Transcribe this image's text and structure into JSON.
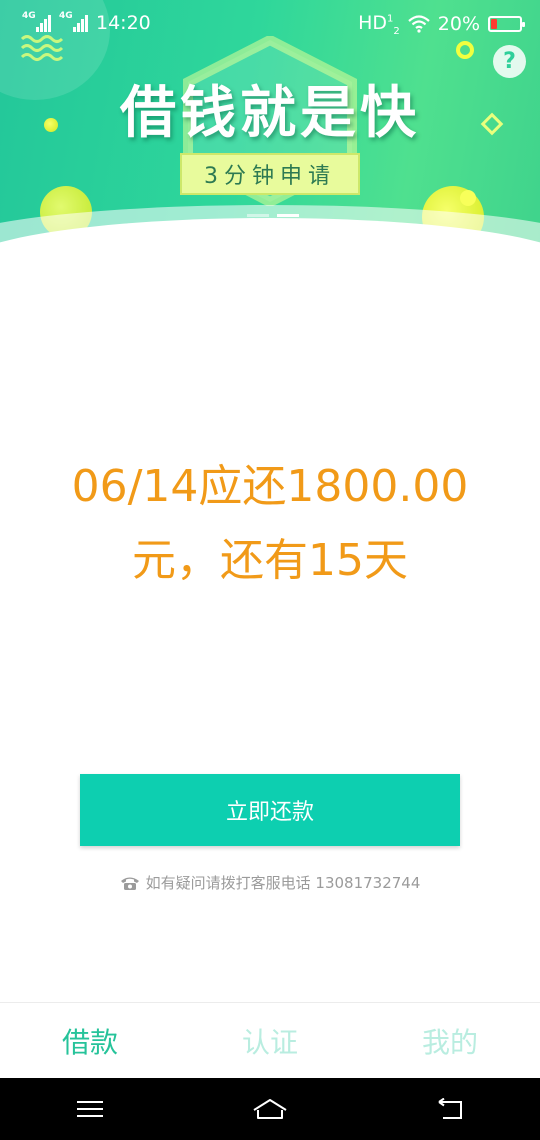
{
  "status_bar": {
    "network_1": "4G",
    "network_2": "4G",
    "time": "14:20",
    "hd": "HD",
    "battery": "20%"
  },
  "banner": {
    "title": "借钱就是快",
    "badge": "3分钟申请"
  },
  "loan": {
    "due_line1": "06/14应还1800.00",
    "due_line2": "元，还有15天"
  },
  "actions": {
    "repay_label": "立即还款"
  },
  "support": {
    "text": "如有疑问请拨打客服电话 13081732744"
  },
  "tabs": [
    {
      "label": "借款",
      "active": true
    },
    {
      "label": "认证",
      "active": false
    },
    {
      "label": "我的",
      "active": false
    }
  ],
  "colors": {
    "accent": "#0dcfb0",
    "due_text": "#f19a18",
    "tab_active": "#26c39a",
    "tab_inactive": "#b9ede0"
  },
  "icons": [
    "help-icon",
    "phone-icon",
    "menu-icon",
    "home-icon",
    "back-icon",
    "wifi-icon",
    "battery-icon",
    "signal-icon"
  ]
}
